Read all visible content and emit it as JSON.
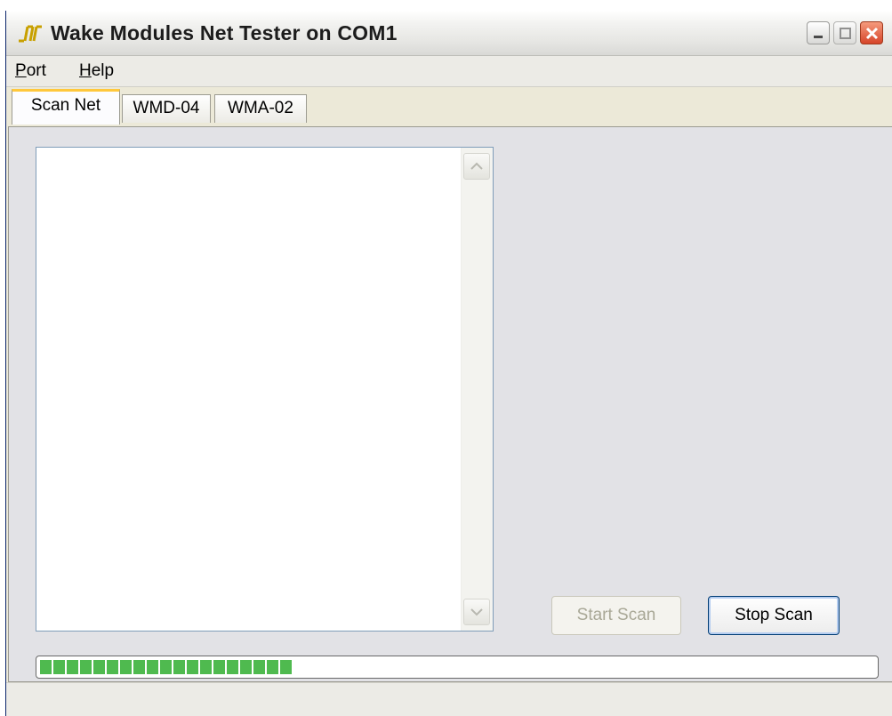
{
  "window": {
    "title": "Wake Modules Net Tester on COM1",
    "icon": "wake-app-icon",
    "controls": [
      "minimize-icon",
      "maximize-icon",
      "close-icon"
    ]
  },
  "menu": {
    "port": {
      "mnemonic": "P",
      "rest": "ort"
    },
    "help": {
      "mnemonic": "H",
      "rest": "elp"
    }
  },
  "tabs": [
    {
      "label": "Scan Net",
      "active": true
    },
    {
      "label": "WMD-04",
      "active": false
    },
    {
      "label": "WMA-02",
      "active": false
    }
  ],
  "scan_panel": {
    "results": [],
    "start_button": {
      "label": "Start Scan",
      "enabled": false
    },
    "stop_button": {
      "label": "Stop Scan",
      "enabled": true
    },
    "progress": {
      "value": 0.3
    }
  },
  "colors": {
    "progress_fill": "#4fba4f",
    "active_tab_accent": "#ffc83c",
    "panel_background": "#e2e2e6"
  }
}
